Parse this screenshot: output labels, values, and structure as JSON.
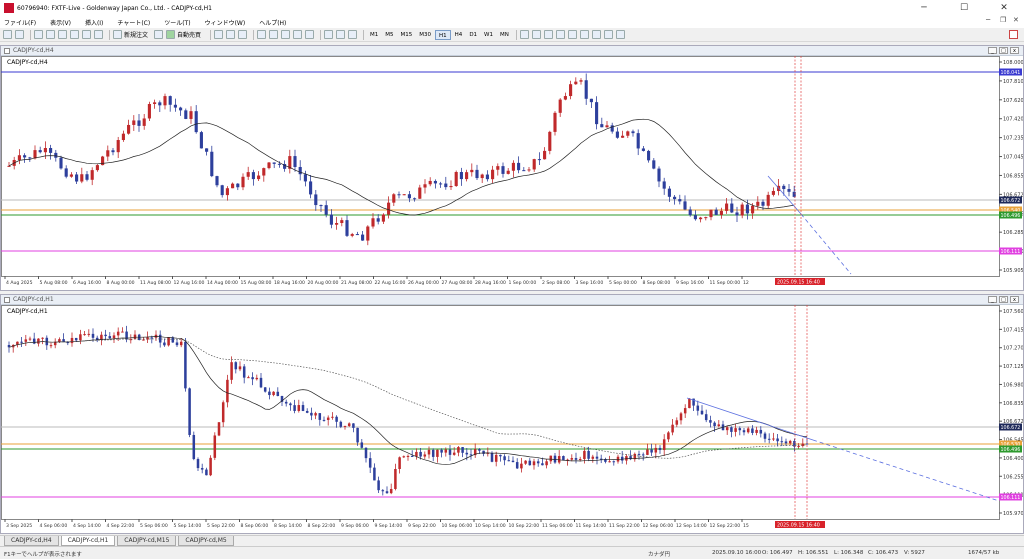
{
  "window": {
    "title": "60796940: FXTF-Live - Goldenway Japan Co., Ltd. - CADJPY-cd,H1",
    "minimize": "─",
    "maximize": "☐",
    "close": "✕"
  },
  "menu": [
    "ファイル(F)",
    "表示(V)",
    "挿入(I)",
    "チャート(C)",
    "ツール(T)",
    "ウィンドウ(W)",
    "ヘルプ(H)"
  ],
  "toolbar": {
    "new_order": "新規注文",
    "auto_trade": "自動売買",
    "timeframes": [
      "M1",
      "M5",
      "M15",
      "M30",
      "H1",
      "H4",
      "D1",
      "W1",
      "MN"
    ],
    "active_timeframe": "H1"
  },
  "chart_h4": {
    "caption": "CADJPY-cd,H4",
    "label": "CADJPY-cd,H4",
    "price_axis": [
      "108.000",
      "107.810",
      "107.620",
      "107.420",
      "107.235",
      "107.045",
      "106.855",
      "106.672",
      "106.496",
      "106.285",
      "106.100",
      "105.905"
    ],
    "top_line_label": "108.041",
    "current_price": "106.672",
    "green_line_label": "106.496",
    "orange_line_label": "106.540",
    "magenta_line_label": "106.111",
    "time_axis": [
      "4 Aug 2025",
      "5 Aug 08:00",
      "6 Aug 16:00",
      "8 Aug 00:00",
      "11 Aug 08:00",
      "12 Aug 16:00",
      "14 Aug 00:00",
      "15 Aug 08:00",
      "18 Aug 16:00",
      "20 Aug 00:00",
      "21 Aug 08:00",
      "22 Aug 16:00",
      "26 Aug 00:00",
      "27 Aug 08:00",
      "28 Aug 16:00",
      "1 Sep 00:00",
      "2 Sep 08:00",
      "3 Sep 16:00",
      "5 Sep 00:00",
      "8 Sep 08:00",
      "9 Sep 16:00",
      "11 Sep 00:00",
      "12"
    ],
    "time_highlight": "2025.09.15 16:40",
    "time_axis_tail": "00"
  },
  "chart_h1": {
    "caption": "CADJPY-cd,H1",
    "label": "CADJPY-cd,H1",
    "price_axis": [
      "107.560",
      "107.415",
      "107.270",
      "107.125",
      "106.980",
      "106.835",
      "106.672",
      "106.545",
      "106.400",
      "106.255",
      "106.111",
      "105.970"
    ],
    "current_price": "106.672",
    "green_line_label": "106.496",
    "orange_line_label": "106.530",
    "magenta_line_label": "106.111",
    "time_axis": [
      "3 Sep 2025",
      "4 Sep 06:00",
      "4 Sep 14:00",
      "4 Sep 22:00",
      "5 Sep 06:00",
      "5 Sep 14:00",
      "5 Sep 22:00",
      "8 Sep 06:00",
      "8 Sep 14:00",
      "8 Sep 22:00",
      "9 Sep 06:00",
      "9 Sep 14:00",
      "9 Sep 22:00",
      "10 Sep 06:00",
      "10 Sep 14:00",
      "10 Sep 22:00",
      "11 Sep 06:00",
      "11 Sep 14:00",
      "11 Sep 22:00",
      "12 Sep 06:00",
      "12 Sep 14:00",
      "12 Sep 22:00",
      "15"
    ],
    "time_highlight": "2025.09.15 16:40"
  },
  "tabs": [
    "CADJPY-cd,H4",
    "CADJPY-cd,H1",
    "CADJPY-cd,M15",
    "CADJPY-cd,M5"
  ],
  "active_tab": "CADJPY-cd,H1",
  "status": {
    "help": "F1キーでヘルプが表示されます",
    "profile": "カナダ円",
    "datetime": "2025.09.10 16:00",
    "open": "O: 106.497",
    "high": "H: 106.551",
    "low": "L: 106.348",
    "close": "C: 106.473",
    "volume": "V: 5927",
    "traffic": "1674/57 kb"
  },
  "colors": {
    "bull": "#c0292b",
    "bear": "#2d3f9c",
    "ma": "#222222",
    "hline_blue": "#3a3ad0",
    "hline_magenta": "#e040e0",
    "hline_green": "#2e9a2e",
    "hline_orange": "#e8a23a",
    "trendline": "#5b6fe0",
    "vline": "#e04040"
  }
}
